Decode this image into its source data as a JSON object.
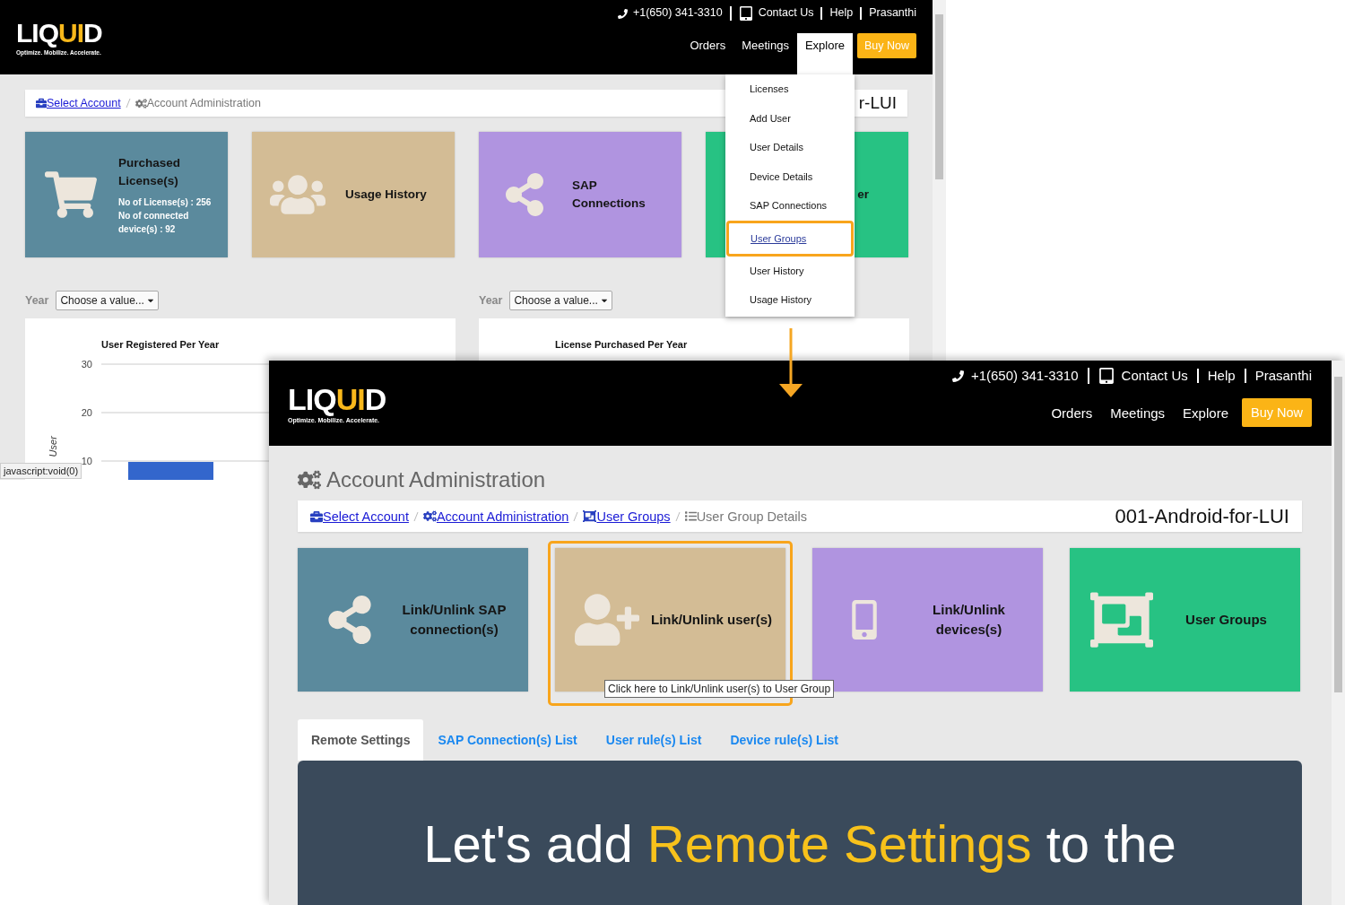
{
  "background_window": {
    "header": {
      "logo": {
        "lead": "LIQ",
        "accent": "UI",
        "tail": "D",
        "tagline": "Optimize. Mobilize. Accelerate."
      },
      "phone": "+1(650) 341-3310",
      "top_links": [
        "Contact Us",
        "Help",
        "Prasanthi"
      ],
      "nav": [
        {
          "label": "Orders",
          "selected": false
        },
        {
          "label": "Meetings",
          "selected": false
        },
        {
          "label": "Explore",
          "selected": true
        }
      ],
      "buy_button": "Buy Now"
    },
    "breadcrumb": {
      "items": [
        {
          "label": "Select Account",
          "kind": "link"
        },
        {
          "label": "Account Administration",
          "kind": "current"
        }
      ],
      "account": "r-LUI"
    },
    "tiles": [
      {
        "title": "Purchased License(s)",
        "color": "#5b8a9d",
        "details": [
          "No of License(s) : 256",
          "No of connected device(s) : 92"
        ]
      },
      {
        "title": "Usage History",
        "color": "#d3bc95"
      },
      {
        "title": "SAP Connections",
        "color": "#b094e0"
      },
      {
        "title": "er",
        "color": "#27c283"
      }
    ],
    "year_filters": [
      {
        "label": "Year",
        "value": "Choose a value..."
      },
      {
        "label": "Year",
        "value": "Choose a value..."
      }
    ],
    "charts": [
      {
        "chart_data": {
          "type": "bar",
          "title": "User Registered Per Year",
          "ylabel": "User",
          "ylim": [
            0,
            30
          ],
          "yticks": [
            10,
            20,
            30
          ],
          "values": [
            10
          ]
        }
      },
      {
        "title": "License Purchased Per Year"
      }
    ],
    "explore_menu": {
      "items": [
        {
          "label": "Licenses",
          "selected": false
        },
        {
          "label": "Add User",
          "selected": false
        },
        {
          "label": "User Details",
          "selected": false
        },
        {
          "label": "Device Details",
          "selected": false
        },
        {
          "label": "SAP Connections",
          "selected": false
        },
        {
          "label": "User Groups",
          "selected": true
        },
        {
          "label": "User History",
          "selected": false
        },
        {
          "label": "Usage History",
          "selected": false
        }
      ]
    },
    "status_text": "javascript:void(0)"
  },
  "foreground_window": {
    "header": {
      "logo": {
        "lead": "LIQ",
        "accent": "UI",
        "tail": "D",
        "tagline": "Optimize. Mobilize. Accelerate."
      },
      "phone": "+1(650) 341-3310",
      "top_links": [
        "Contact Us",
        "Help",
        "Prasanthi"
      ],
      "nav": [
        {
          "label": "Orders",
          "selected": false
        },
        {
          "label": "Meetings",
          "selected": false
        },
        {
          "label": "Explore",
          "selected": false
        }
      ],
      "buy_button": "Buy Now"
    },
    "page_title": "Account Administration",
    "breadcrumb": {
      "items": [
        {
          "label": "Select Account",
          "kind": "link"
        },
        {
          "label": "Account Administration",
          "kind": "link"
        },
        {
          "label": "User Groups",
          "kind": "link"
        },
        {
          "label": "User Group Details",
          "kind": "current"
        }
      ],
      "account": "001-Android-for-LUI"
    },
    "tiles": [
      {
        "title": "Link/Unlink SAP connection(s)",
        "color": "#5b8a9d",
        "highlighted": false
      },
      {
        "title": "Link/Unlink user(s)",
        "color": "#d3bc95",
        "highlighted": true,
        "tooltip": "Click here to Link/Unlink user(s) to User Group"
      },
      {
        "title": "Link/Unlink devices(s)",
        "color": "#b094e0",
        "highlighted": false
      },
      {
        "title": "User Groups",
        "color": "#27c283",
        "highlighted": false
      }
    ],
    "tabs": [
      {
        "label": "Remote Settings",
        "selected": true
      },
      {
        "label": "SAP Connection(s) List",
        "selected": false
      },
      {
        "label": "User rule(s) List",
        "selected": false
      },
      {
        "label": "Device rule(s) List",
        "selected": false
      }
    ],
    "banner": {
      "before": "Let's add ",
      "highlight": "Remote Settings",
      "after": " to the"
    }
  }
}
